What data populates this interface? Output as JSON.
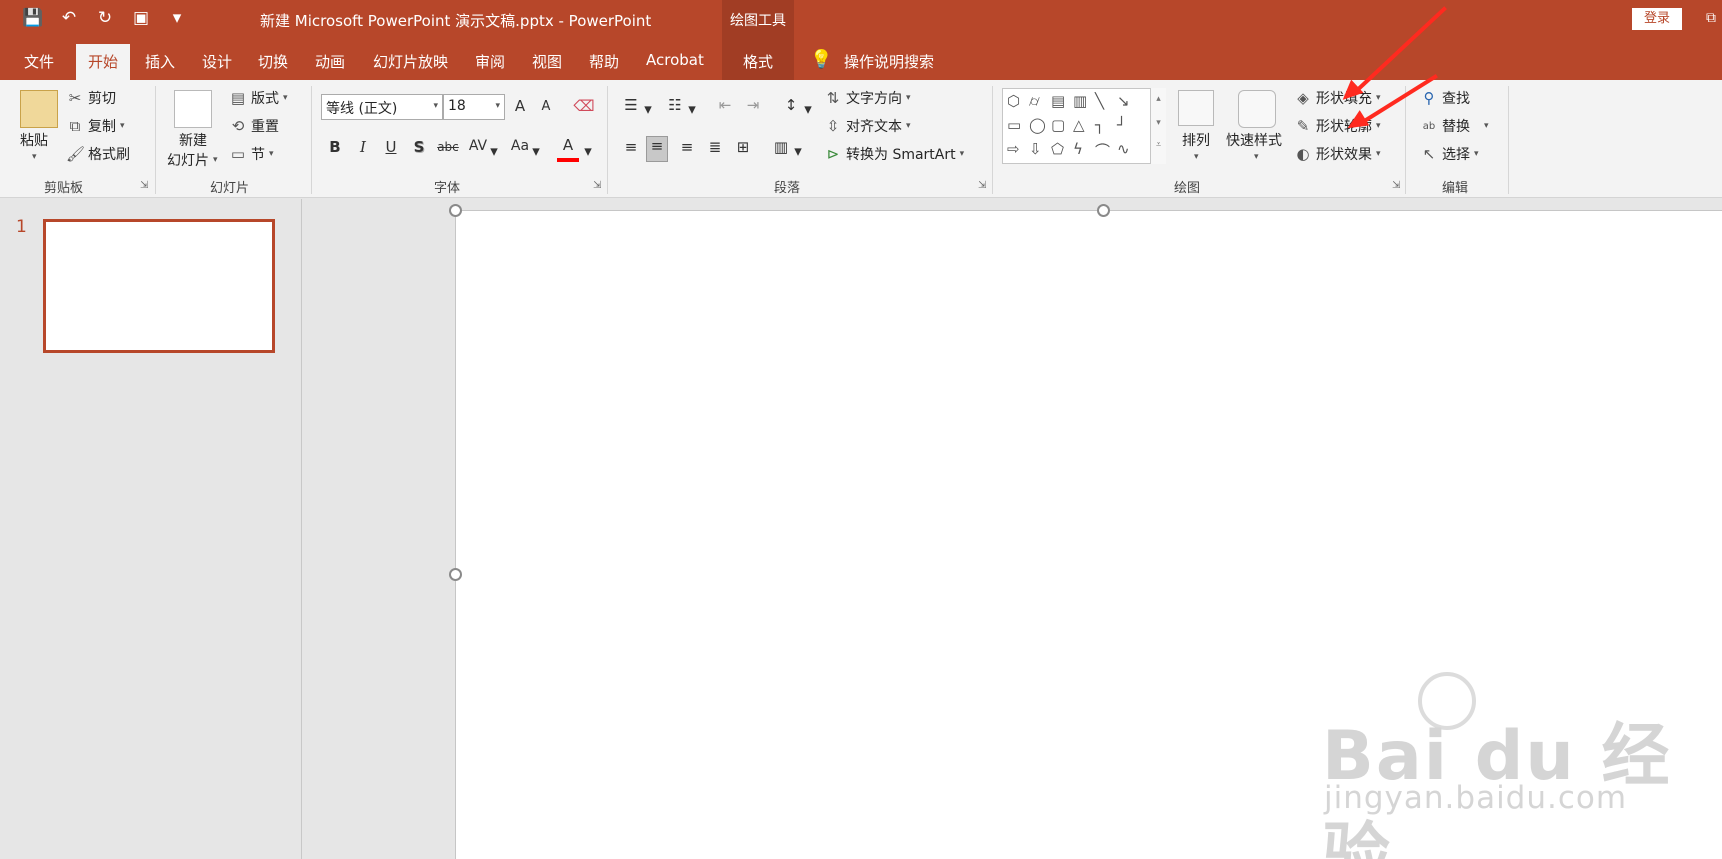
{
  "window": {
    "title": "新建 Microsoft PowerPoint 演示文稿.pptx  -  PowerPoint",
    "context_tools": "绘图工具",
    "login_label": "登录"
  },
  "qat": {
    "save": "💾",
    "undo": "↶",
    "redo": "↻",
    "present": "▣",
    "more": "▾"
  },
  "tabs": [
    "文件",
    "开始",
    "插入",
    "设计",
    "切换",
    "动画",
    "幻灯片放映",
    "审阅",
    "视图",
    "帮助",
    "Acrobat",
    "格式"
  ],
  "active_tab": "开始",
  "tell_me": "操作说明搜索",
  "ribbon": {
    "clipboard": {
      "paste": "粘贴",
      "cut": "剪切",
      "copy": "复制",
      "format_painter": "格式刷",
      "label": "剪贴板"
    },
    "slides": {
      "new_slide_line1": "新建",
      "new_slide_line2": "幻灯片",
      "layout": "版式",
      "reset": "重置",
      "section": "节",
      "label": "幻灯片"
    },
    "font": {
      "name": "等线 (正文)",
      "size": "18",
      "bold": "B",
      "italic": "I",
      "underline": "U",
      "shadow": "S",
      "strike": "abc",
      "spacing": "AV",
      "case": "Aa",
      "grow": "A",
      "shrink": "A",
      "color": "A",
      "label": "字体"
    },
    "paragraph": {
      "text_direction": "文字方向",
      "align_text": "对齐文本",
      "smartart": "转换为 SmartArt",
      "label": "段落"
    },
    "drawing": {
      "arrange": "排列",
      "quick_styles": "快速样式",
      "shape_fill": "形状填充",
      "shape_outline": "形状轮廓",
      "shape_effects": "形状效果",
      "label": "绘图"
    },
    "editing": {
      "find": "查找",
      "replace": "替换",
      "select": "选择",
      "label": "编辑"
    }
  },
  "slides_pane": {
    "slide_number": "1"
  },
  "watermark": {
    "brand": "Bai du 经验",
    "url": "jingyan.baidu.com"
  },
  "colors": {
    "accent": "#b7472a",
    "annotation_arrow": "#ff2a1f"
  }
}
